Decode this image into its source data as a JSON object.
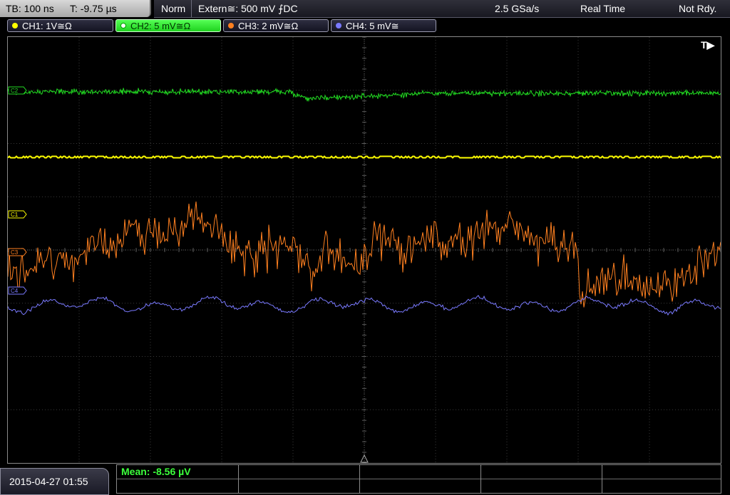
{
  "topbar": {
    "timebase": "TB: 100 ns",
    "trigger_time": "T: -9.75 µs",
    "trigger_mode": "Norm",
    "trigger_source": "Extern≅: 500 mV ⨍DC",
    "sample_rate": "2.5 GSa/s",
    "acq_mode": "Real Time",
    "status": "Not Rdy."
  },
  "channels": [
    {
      "id": "CH1",
      "label": "CH1: 1V≅Ω",
      "color": "#ffff00",
      "marker": "C1"
    },
    {
      "id": "CH2",
      "label": "CH2: 5 mV≅Ω",
      "color": "#22dd22",
      "marker": "C2"
    },
    {
      "id": "CH3",
      "label": "CH3: 2 mV≅Ω",
      "color": "#ff8020",
      "marker": "C3"
    },
    {
      "id": "CH4",
      "label": "CH4: 5 mV≅",
      "color": "#7a7aff",
      "marker": "C4"
    }
  ],
  "trigger_marker": "T▶",
  "bottom": {
    "datetime": "2015-04-27 01:55",
    "measurement": "Mean: -8.56 µV"
  },
  "colors": {
    "grid": "#3a3a3a",
    "axis": "#5a5a5a",
    "ch1": "#ffff00",
    "ch2": "#22dd22",
    "ch3": "#ff8020",
    "ch4": "#7a7aff"
  }
}
